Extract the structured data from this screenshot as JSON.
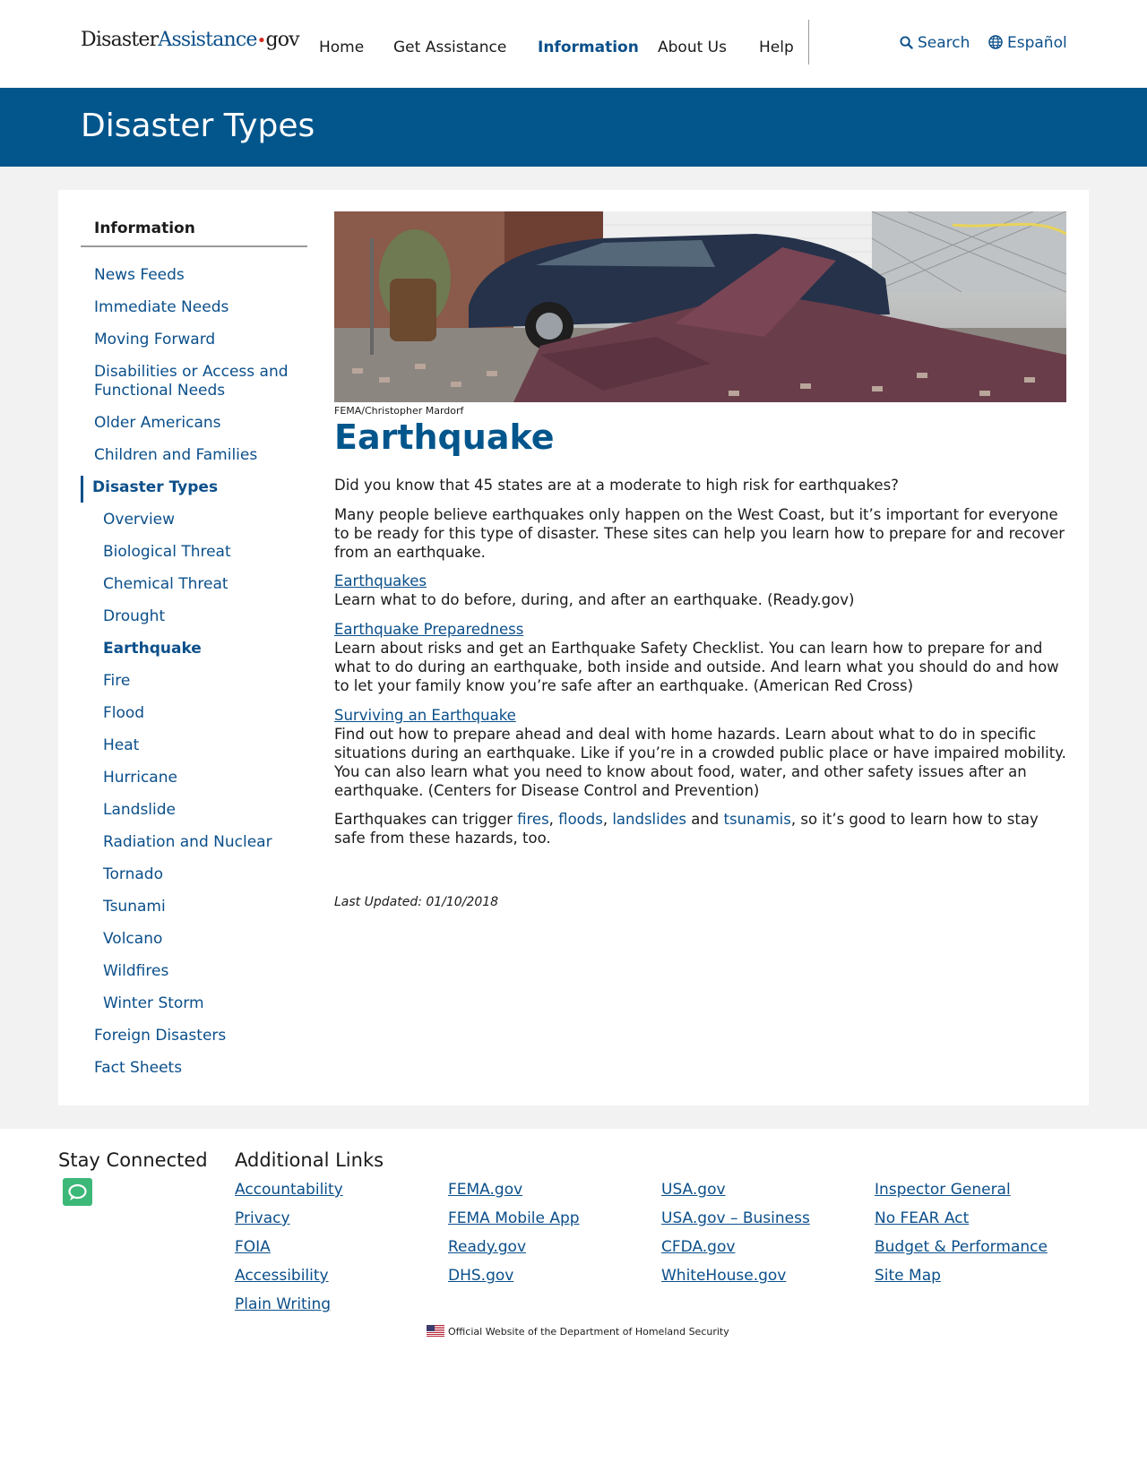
{
  "header": {
    "logo": {
      "part1": "Disaster",
      "part2": "Assistance",
      "dot": "•",
      "part3": "gov"
    },
    "nav": [
      {
        "label": "Home"
      },
      {
        "label": "Get Assistance"
      },
      {
        "label": "Information"
      },
      {
        "label": "About Us"
      },
      {
        "label": "Help"
      }
    ],
    "search_label": "Search",
    "language_label": "Español"
  },
  "banner": {
    "title": "Disaster Types"
  },
  "sidebar": {
    "heading": "Information",
    "items": [
      {
        "label": "News Feeds"
      },
      {
        "label": "Immediate Needs"
      },
      {
        "label": "Moving Forward"
      },
      {
        "label": "Disabilities or Access and"
      },
      {
        "label": "Functional Needs"
      },
      {
        "label": "Older Americans"
      },
      {
        "label": "Children and Families"
      },
      {
        "label": "Disaster Types"
      },
      {
        "label": "Foreign Disasters"
      },
      {
        "label": "Fact Sheets"
      }
    ],
    "subitems": [
      {
        "label": "Overview"
      },
      {
        "label": "Biological Threat"
      },
      {
        "label": "Chemical Threat"
      },
      {
        "label": "Drought"
      },
      {
        "label": "Earthquake"
      },
      {
        "label": "Fire"
      },
      {
        "label": "Flood"
      },
      {
        "label": "Heat"
      },
      {
        "label": "Hurricane"
      },
      {
        "label": "Landslide"
      },
      {
        "label": "Radiation and Nuclear"
      },
      {
        "label": "Tornado"
      },
      {
        "label": "Tsunami"
      },
      {
        "label": "Volcano"
      },
      {
        "label": "Wildfires"
      },
      {
        "label": "Winter Storm"
      }
    ]
  },
  "content": {
    "image_credit": "FEMA/Christopher Mardorf",
    "title": "Earthquake",
    "intro": "Did you know that 45 states are at a moderate to high risk for earthquakes?",
    "intro2": "Many people believe earthquakes only happen on the West Coast, but it’s important for everyone to be ready for this type of disaster. These sites can help you learn how to prepare for and recover from an earthquake.",
    "resources": [
      {
        "link": "Earthquakes",
        "text": "Learn what to do before, during, and after an earthquake. (Ready.gov)"
      },
      {
        "link": "Earthquake Preparedness",
        "text": "Learn about risks and get an Earthquake Safety Checklist. You can learn how to prepare for and what to do during an earthquake, both inside and outside. And learn what you should do and how to let your family know you’re safe after an earthquake. (American Red Cross)"
      },
      {
        "link": "Surviving an Earthquake",
        "text": "Find out how to prepare ahead and deal with home hazards. Learn about what to do in specific situations during an earthquake. Like if you’re in a crowded public place or have impaired mobility. You can also learn what you need to know about food, water, and other safety issues after an earthquake. (Centers for Disease Control and Prevention)"
      }
    ],
    "closing": {
      "before": "Earthquakes can trigger ",
      "link1": "fires",
      "sep1": ", ",
      "link2": "floods",
      "sep2": ", ",
      "link3": "landslides",
      "sep3": " and ",
      "link4": "tsunamis",
      "after": ", so it’s good to learn how to stay safe from these hazards, too."
    },
    "last_updated": "Last Updated: 01/10/2018"
  },
  "footer": {
    "stay_connected": "Stay Connected",
    "additional_links": "Additional Links",
    "col1": [
      "Accountability",
      "Privacy",
      "FOIA",
      "Accessibility",
      "Plain Writing"
    ],
    "col2": [
      "FEMA.gov",
      "FEMA Mobile App",
      "Ready.gov",
      "DHS.gov"
    ],
    "col3": [
      "USA.gov",
      "USA.gov – Business",
      "CFDA.gov",
      "WhiteHouse.gov"
    ],
    "col4": [
      "Inspector General",
      "No FEAR Act",
      "Budget & Performance",
      "Site Map"
    ],
    "official": "Official Website of the Department of Homeland Security"
  },
  "colors": {
    "brand_blue": "#03568c",
    "link_blue": "#0b4f8a",
    "chat_green": "#3cb878"
  }
}
